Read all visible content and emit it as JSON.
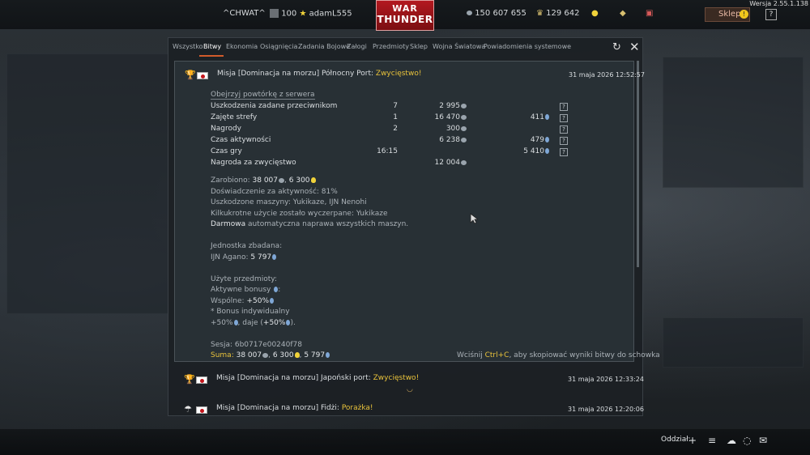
{
  "version": "Wersja 2.55.1.138",
  "topbar": {
    "username_tag": "^CHWAT^",
    "rank": "100",
    "player": "adamL555",
    "logo_line1": "WAR",
    "logo_line2": "THUNDER",
    "silver": "150 607 655",
    "gold": "129 642",
    "shop_label": "Sklep",
    "help": "?"
  },
  "tabs": [
    "Wszystko",
    "Bitwy",
    "Ekonomia",
    "Osiągnięcia",
    "Zadania Bojowe",
    "Załogi",
    "Przedmioty",
    "Sklep",
    "Wojna Światowa",
    "Powiadomienia systemowe"
  ],
  "active_tab": "Bitwy",
  "entry1": {
    "title_prefix": "Misja [Dominacja na morzu] Północny Port: ",
    "result": "Zwycięstwo!",
    "date": "31 maja 2026 12:52:57",
    "replay_link": "Obejrzyj powtórkę z serwera",
    "stats": [
      {
        "label": "Uszkodzenia zadane przeciwnikom",
        "count": "7",
        "silver": "2 995",
        "rp": "",
        "q": "?"
      },
      {
        "label": "Zajęte strefy",
        "count": "1",
        "silver": "16 470",
        "rp": "411",
        "q": "?"
      },
      {
        "label": "Nagrody",
        "count": "2",
        "silver": "300",
        "rp": "",
        "q": "?"
      },
      {
        "label": "Czas aktywności",
        "count": "",
        "silver": "6 238",
        "rp": "479",
        "q": "?"
      },
      {
        "label": "Czas gry",
        "count": "16:15",
        "silver": "",
        "rp": "5 410",
        "q": "?"
      },
      {
        "label": "Nagroda za zwycięstwo",
        "count": "",
        "silver": "12 004",
        "rp": "",
        "q": ""
      }
    ],
    "earned_label": "Zarobiono: ",
    "earned_silver": "38 007",
    "earned_gold": "6 300",
    "activity_xp": "Doświadczenie za aktywność: 81%",
    "damaged_vehicles": "Uszkodzone maszyny: Yukikaze, IJN Nenohi",
    "multi_use": "Kilkukrotne użycie zostało wyczerpane: Yukikaze",
    "free_repair_bold": "Darmowa",
    "free_repair_rest": " automatyczna naprawa wszystkich maszyn.",
    "research_header": "Jednostka zbadana:",
    "research_unit": "IJN Agano: ",
    "research_rp": "5 797",
    "items_header": "Użyte przedmioty:",
    "active_bonuses": "Aktywne bonusy ",
    "shared_label": "Wspólne: ",
    "shared_value": "+50%",
    "individual": "* Bonus indywidualny",
    "bonus_line_a": "+50%",
    "bonus_line_b": ", daje (",
    "bonus_line_c": "+50%",
    "bonus_line_d": ").",
    "session": "Sesja: 6b0717e00240f78",
    "sum_label": "Suma: ",
    "sum_silver": "38 007",
    "sum_gold": "6 300",
    "sum_rp": "5 797",
    "hint_prefix": "Wciśnij ",
    "hint_key": "Ctrl+C",
    "hint_suffix": ", aby skopiować wyniki bitwy do schowka"
  },
  "entry2": {
    "title_prefix": "Misja [Dominacja na morzu] Japoński port: ",
    "result": "Zwycięstwo!",
    "date": "31 maja 2026 12:33:24"
  },
  "entry3": {
    "title_prefix": "Misja [Dominacja na morzu] Fidżi: ",
    "result": "Porażka!",
    "date": "31 maja 2026 12:20:06"
  },
  "bottombar": {
    "squad_label": "Oddział:"
  }
}
